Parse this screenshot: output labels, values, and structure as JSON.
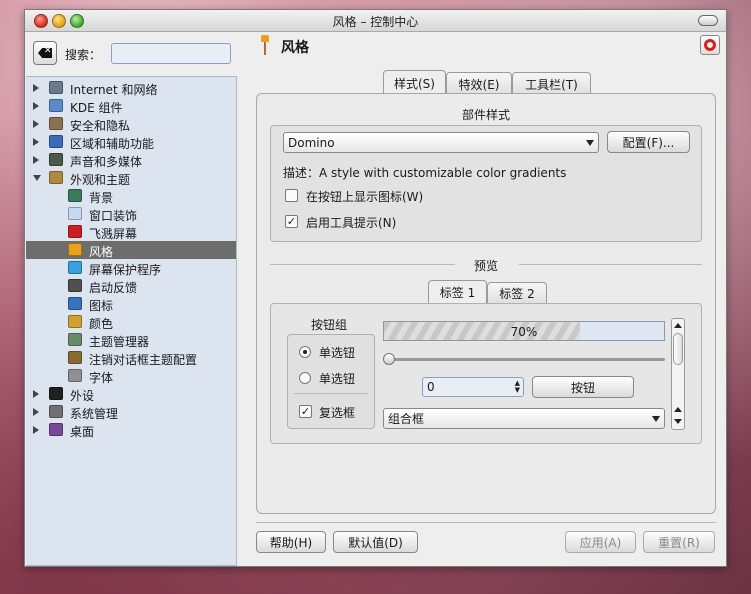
{
  "window": {
    "title": "风格 – 控制中心"
  },
  "sidebar": {
    "search_label": "搜索：",
    "search_value": "",
    "items": [
      {
        "label": "Internet 和网络",
        "icon": "network-icon",
        "color": "#6a7a8a"
      },
      {
        "label": "KDE 组件",
        "icon": "kde-components-icon",
        "color": "#5a8ac8"
      },
      {
        "label": "安全和隐私",
        "icon": "security-icon",
        "color": "#8a7050"
      },
      {
        "label": "区域和辅助功能",
        "icon": "regional-icon",
        "color": "#3a6ab8"
      },
      {
        "label": "声音和多媒体",
        "icon": "sound-icon",
        "color": "#4a5a4a"
      },
      {
        "label": "外观和主题",
        "icon": "appearance-icon",
        "color": "#b08a40"
      },
      {
        "label": "背景",
        "icon": "background-icon",
        "color": "#3a7a5a"
      },
      {
        "label": "窗口装饰",
        "icon": "window-decoration-icon",
        "color": "#c8d8f0"
      },
      {
        "label": "飞溅屏幕",
        "icon": "splash-screen-icon",
        "color": "#c82020"
      },
      {
        "label": "风格",
        "icon": "style-icon",
        "color": "#e8a020"
      },
      {
        "label": "屏幕保护程序",
        "icon": "screensaver-icon",
        "color": "#3aa0e0"
      },
      {
        "label": "启动反馈",
        "icon": "launch-feedback-icon",
        "color": "#505050"
      },
      {
        "label": "图标",
        "icon": "icons-icon",
        "color": "#3a70c0"
      },
      {
        "label": "颜色",
        "icon": "colors-icon",
        "color": "#d0a030"
      },
      {
        "label": "主题管理器",
        "icon": "theme-manager-icon",
        "color": "#6a8a6a"
      },
      {
        "label": "注销对话框主题配置",
        "icon": "logout-theme-icon",
        "color": "#8a6a30"
      },
      {
        "label": "字体",
        "icon": "fonts-icon",
        "color": "#909090"
      },
      {
        "label": "外设",
        "icon": "peripherals-icon",
        "color": "#202020"
      },
      {
        "label": "系统管理",
        "icon": "system-admin-icon",
        "color": "#707070"
      },
      {
        "label": "桌面",
        "icon": "desktop-icon",
        "color": "#7a4a9a"
      }
    ]
  },
  "panel": {
    "title": "风格"
  },
  "tabs": {
    "style": "样式(S)",
    "effects": "特效(E)",
    "toolbar": "工具栏(T)"
  },
  "widget_style": {
    "section_title": "部件样式",
    "selected": "Domino",
    "configure_label": "配置(F)...",
    "description": "描述：A style with customizable color gradients",
    "show_icons_label": "在按钮上显示图标(W)",
    "show_icons_checked": false,
    "tooltips_label": "启用工具提示(N)",
    "tooltips_checked": true
  },
  "preview": {
    "section_title": "预览",
    "tab1": "标签 1",
    "tab2": "标签 2",
    "group_title": "按钮组",
    "radio1": "单选钮",
    "radio2": "单选钮",
    "checkbox": "复选框",
    "progress_value": 70,
    "progress_text": "70%",
    "slider_value": 0,
    "spin_value": "0",
    "button_label": "按钮",
    "combo_label": "组合框"
  },
  "footer": {
    "help": "帮助(H)",
    "defaults": "默认值(D)",
    "apply": "应用(A)",
    "reset": "重置(R)"
  }
}
